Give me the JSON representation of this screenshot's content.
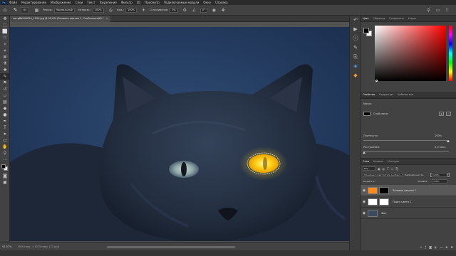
{
  "menubar": {
    "app_logo": "Ps",
    "items": [
      "Файл",
      "Редактирование",
      "Изображение",
      "Слои",
      "Текст",
      "Выделение",
      "Фильтр",
      "3D",
      "Просмотр",
      "Подключаемые модули",
      "Окно",
      "Справка"
    ]
  },
  "options": {
    "brush_size": "65",
    "mode_label": "Режим:",
    "mode_value": "Нормальный",
    "opacity_label": "Непрозр.:",
    "opacity_value": "100%",
    "flow_label": "Наж.:",
    "flow_value": "100%",
    "smoothing_label": "Сглаживание:",
    "smoothing_value": "0%",
    "angle_value": "0°"
  },
  "document": {
    "tab_title": "cat-g8b949024_1920.jpg @ 92,6% (Заливка цветом 1, Слой-маска/8) *",
    "close": "×"
  },
  "status": {
    "zoom": "92,57%",
    "info": "1920 пикс. x 1275 пикс. (72 ppi)"
  },
  "color_panel": {
    "tabs": [
      "Цвет",
      "Образцы",
      "Градиенты",
      "Узоры"
    ],
    "fg": "#000000",
    "bg": "#ffffff"
  },
  "properties_panel": {
    "tabs": [
      "Свойства",
      "Коррекция",
      "Библиотеки"
    ],
    "section": "Маски",
    "layer_mask_label": "Слой-маска",
    "density_label": "Плотность:",
    "density_value": "100%",
    "feather_label": "Растушевка:",
    "feather_value": "0,0 пикс.",
    "refine_label": "Уточнить:"
  },
  "layers_panel": {
    "tabs": [
      "Слои",
      "Каналы",
      "Контуры"
    ],
    "filter_label": "Вид",
    "blend_mode": "Линейный осветлитель (добавл...",
    "opacity_label": "Непрозрачность:",
    "opacity_value": "100%",
    "lock_label": "Закрепить:",
    "fill_label": "Заливка:",
    "fill_value": "100%",
    "layers": [
      {
        "name": "Заливка цветом 1",
        "thumb": "#ff8c1a",
        "mask": "#000000",
        "selected": true
      },
      {
        "name": "Поиск цвета 1",
        "thumb": "#ffffff",
        "mask": "#ffffff",
        "selected": false
      },
      {
        "name": "Фон",
        "thumb": "#3a4a60",
        "mask": "",
        "selected": false
      }
    ]
  },
  "colors": {
    "accent": "#31a8ff",
    "eye_glow": "#ffd21a",
    "orange": "#ff8c1a"
  }
}
